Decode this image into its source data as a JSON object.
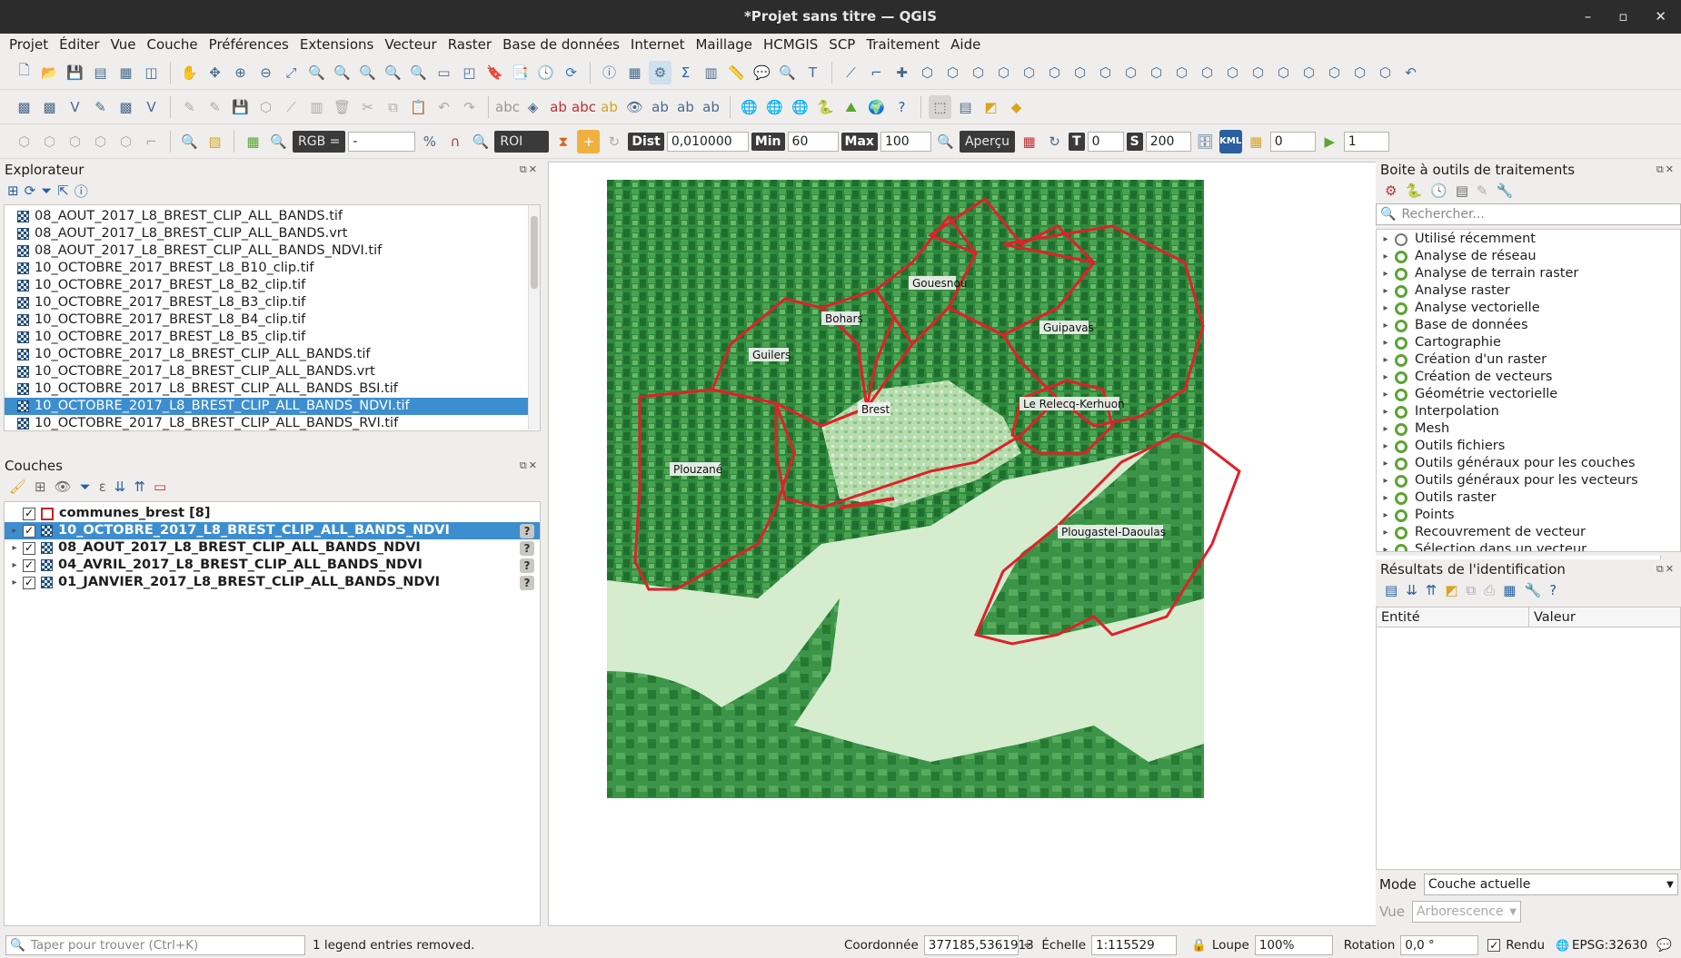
{
  "window": {
    "title": "*Projet sans titre — QGIS",
    "buttons": [
      "–",
      "▫",
      "✕"
    ]
  },
  "menubar": [
    "Projet",
    "Éditer",
    "Vue",
    "Couche",
    "Préférences",
    "Extensions",
    "Vecteur",
    "Raster",
    "Base de données",
    "Internet",
    "Maillage",
    "HCMGIS",
    "SCP",
    "Traitement",
    "Aide"
  ],
  "scp_toolbar": {
    "rgb_label": "RGB =",
    "rgb_value": "-",
    "roi_label": "ROI",
    "dist_label": "Dist",
    "dist_value": "0,010000",
    "min_label": "Min",
    "min_value": "60",
    "max_label": "Max",
    "max_value": "100",
    "apercu_label": "Aperçu",
    "t_label": "T",
    "t_value": "0",
    "s_label": "S",
    "s_value": "200",
    "kml_label": "KML",
    "band_value": "0",
    "band2_value": "1"
  },
  "explorer": {
    "title": "Explorateur",
    "items": [
      "08_AOUT_2017_L8_BREST_CLIP_ALL_BANDS.tif",
      "08_AOUT_2017_L8_BREST_CLIP_ALL_BANDS.vrt",
      "08_AOUT_2017_L8_BREST_CLIP_ALL_BANDS_NDVI.tif",
      "10_OCTOBRE_2017_BREST_L8_B10_clip.tif",
      "10_OCTOBRE_2017_BREST_L8_B2_clip.tif",
      "10_OCTOBRE_2017_BREST_L8_B3_clip.tif",
      "10_OCTOBRE_2017_BREST_L8_B4_clip.tif",
      "10_OCTOBRE_2017_BREST_L8_B5_clip.tif",
      "10_OCTOBRE_2017_L8_BREST_CLIP_ALL_BANDS.tif",
      "10_OCTOBRE_2017_L8_BREST_CLIP_ALL_BANDS.vrt",
      "10_OCTOBRE_2017_L8_BREST_CLIP_ALL_BANDS_BSI.tif",
      "10_OCTOBRE_2017_L8_BREST_CLIP_ALL_BANDS_NDVI.tif",
      "10_OCTOBRE_2017_L8_BREST_CLIP_ALL_BANDS_RVI.tif"
    ],
    "selected_index": 11
  },
  "layers": {
    "title": "Couches",
    "items": [
      {
        "name": "communes_brest [8]",
        "type": "vector",
        "checked": true
      },
      {
        "name": "10_OCTOBRE_2017_L8_BREST_CLIP_ALL_BANDS_NDVI",
        "type": "raster",
        "checked": true,
        "selected": true
      },
      {
        "name": "08_AOUT_2017_L8_BREST_CLIP_ALL_BANDS_NDVI",
        "type": "raster",
        "checked": true
      },
      {
        "name": "04_AVRIL_2017_L8_BREST_CLIP_ALL_BANDS_NDVI",
        "type": "raster",
        "checked": true
      },
      {
        "name": "01_JANVIER_2017_L8_BREST_CLIP_ALL_BANDS_NDVI",
        "type": "raster",
        "checked": true
      }
    ]
  },
  "map": {
    "labels": [
      "Gouesnou",
      "Bohars",
      "Guipavas",
      "Guilers",
      "Brest",
      "Le Relecq-Kerhuon",
      "Plouzané",
      "Plougastel-Daoulas"
    ],
    "boundary_color": "#e0202a",
    "dark_green": "#2e7d32",
    "water_green": "#d9efd2"
  },
  "toolbox": {
    "title": "Boite à outils de traitements",
    "search_placeholder": "Rechercher...",
    "items": [
      "Utilisé récemment",
      "Analyse de réseau",
      "Analyse de terrain raster",
      "Analyse raster",
      "Analyse vectorielle",
      "Base de données",
      "Cartographie",
      "Création d'un raster",
      "Création de vecteurs",
      "Géométrie vectorielle",
      "Interpolation",
      "Mesh",
      "Outils fichiers",
      "Outils généraux pour les couches",
      "Outils généraux pour les vecteurs",
      "Outils raster",
      "Points",
      "Recouvrement de vecteur",
      "Sélection dans un vecteur"
    ]
  },
  "identify": {
    "title": "Résultats de l'identification",
    "col_entity": "Entité",
    "col_value": "Valeur",
    "mode_label": "Mode",
    "mode_value": "Couche actuelle",
    "view_label": "Vue",
    "view_value": "Arborescence"
  },
  "statusbar": {
    "locator_placeholder": "Taper pour trouver (Ctrl+K)",
    "message": "1 legend entries removed.",
    "coord_label": "Coordonnée",
    "coord_value": "377185,5361913",
    "scale_label": "Échelle",
    "scale_value": "1:115529",
    "loupe_label": "Loupe",
    "loupe_value": "100%",
    "rotation_label": "Rotation",
    "rotation_value": "0,0 °",
    "render_label": "Rendu",
    "crs": "EPSG:32630"
  }
}
